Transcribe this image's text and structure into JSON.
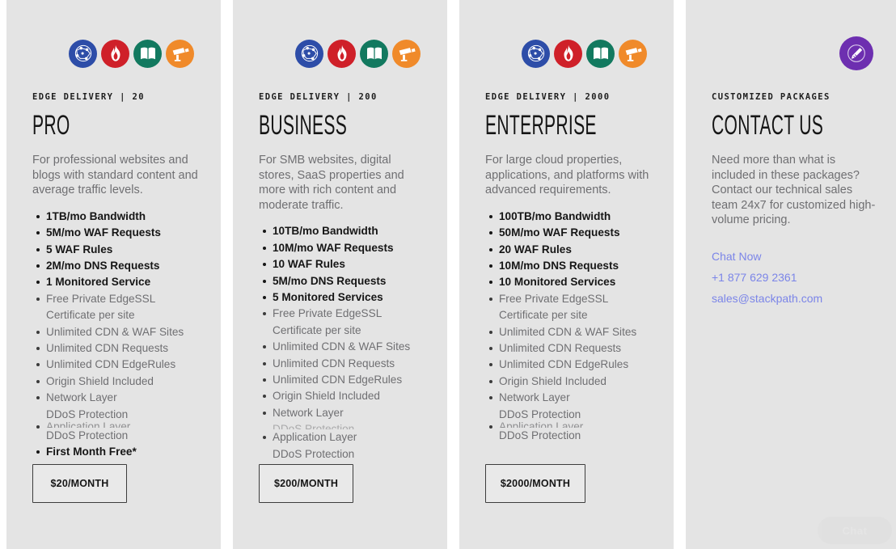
{
  "theme": {
    "page_background": "#ffffff",
    "card_background": "#e4e4e4",
    "text_dark": "#161616",
    "text_muted": "#6f6f72",
    "link_color": "#7b85e8",
    "icon_cdn_color": "#2d4da8",
    "icon_waf_color": "#cf2029",
    "icon_ssl_color": "#12795f",
    "icon_monitoring_color": "#f08a2a",
    "icon_contact_color": "#6d2fb0"
  },
  "feature_icons": [
    {
      "name": "cdn-network-icon",
      "label": "CDN",
      "color": "#2d4da8"
    },
    {
      "name": "waf-flame-icon",
      "label": "WAF",
      "color": "#cf2029"
    },
    {
      "name": "edgessl-book-icon",
      "label": "EdgeSSL",
      "color": "#12795f"
    },
    {
      "name": "monitoring-camera-icon",
      "label": "Monitoring",
      "color": "#f08a2a"
    }
  ],
  "contact_icon": {
    "name": "pencil-icon",
    "label": "Customized",
    "color": "#6d2fb0"
  },
  "plans": [
    {
      "id": "pro",
      "eyebrow": "EDGE DELIVERY  |  20",
      "title": "PRO",
      "description": "For professional websites and blogs with standard content and average traffic levels.",
      "features": [
        {
          "text": "1TB/mo Bandwidth",
          "bold": true
        },
        {
          "text": "5M/mo WAF Requests",
          "bold": true
        },
        {
          "text": "5 WAF Rules",
          "bold": true
        },
        {
          "text": "2M/mo DNS Requests",
          "bold": true
        },
        {
          "text": "1 Monitored Service",
          "bold": true
        },
        {
          "text": "Free Private EdgeSSL Certificate per site",
          "bold": false
        },
        {
          "text": "Unlimited CDN & WAF Sites",
          "bold": false
        },
        {
          "text": "Unlimited CDN Requests",
          "bold": false
        },
        {
          "text": "Unlimited CDN EdgeRules",
          "bold": false
        },
        {
          "text": "Origin Shield Included",
          "bold": false
        },
        {
          "text": "Network Layer",
          "sub": "DDoS Protection",
          "bold": false
        },
        {
          "text": "Application Layer",
          "sub": "DDoS Protection",
          "bold": false,
          "artifact": true
        },
        {
          "text": "First Month Free*",
          "bold": true
        }
      ],
      "price_label": "$20/MONTH"
    },
    {
      "id": "business",
      "eyebrow": "EDGE DELIVERY  |  200",
      "title": "BUSINESS",
      "description": "For SMB websites, digital stores, SaaS properties and more with rich content and moderate traffic.",
      "features": [
        {
          "text": "10TB/mo Bandwidth",
          "bold": true
        },
        {
          "text": "10M/mo WAF Requests",
          "bold": true
        },
        {
          "text": "10 WAF Rules",
          "bold": true
        },
        {
          "text": "5M/mo DNS Requests",
          "bold": true
        },
        {
          "text": "5 Monitored Services",
          "bold": true
        },
        {
          "text": "Free Private EdgeSSL Certificate per site",
          "bold": false
        },
        {
          "text": "Unlimited CDN & WAF Sites",
          "bold": false
        },
        {
          "text": "Unlimited CDN Requests",
          "bold": false
        },
        {
          "text": "Unlimited CDN EdgeRules",
          "bold": false
        },
        {
          "text": "Origin Shield Included",
          "bold": false
        },
        {
          "text": "Network Layer",
          "sub": "DDoS Protection",
          "bold": false,
          "sub_clipped": true
        },
        {
          "text": "Application Layer",
          "sub": "DDoS Protection",
          "bold": false
        }
      ],
      "price_label": "$200/MONTH"
    },
    {
      "id": "enterprise",
      "eyebrow": "EDGE DELIVERY  |  2000",
      "title": "ENTERPRISE",
      "description": "For large cloud properties, applications, and platforms with advanced requirements.",
      "features": [
        {
          "text": "100TB/mo Bandwidth",
          "bold": true
        },
        {
          "text": "50M/mo WAF Requests",
          "bold": true
        },
        {
          "text": "20 WAF Rules",
          "bold": true
        },
        {
          "text": "10M/mo DNS Requests",
          "bold": true
        },
        {
          "text": "10 Monitored Services",
          "bold": true
        },
        {
          "text": "Free Private EdgeSSL Certificate per site",
          "bold": false
        },
        {
          "text": "Unlimited CDN & WAF Sites",
          "bold": false
        },
        {
          "text": "Unlimited CDN Requests",
          "bold": false
        },
        {
          "text": "Unlimited CDN EdgeRules",
          "bold": false
        },
        {
          "text": "Origin Shield Included",
          "bold": false
        },
        {
          "text": "Network Layer",
          "sub": "DDoS Protection",
          "bold": false
        },
        {
          "text": "Application Layer",
          "sub": "DDoS Protection",
          "bold": false,
          "artifact": true
        }
      ],
      "price_label": "$2000/MONTH"
    }
  ],
  "contact_card": {
    "id": "contact",
    "eyebrow": "CUSTOMIZED PACKAGES",
    "title": "CONTACT US",
    "description": "Need more than what is included in these packages? Contact our technical sales team 24x7 for customized high-volume pricing.",
    "links": [
      {
        "name": "chat-now-link",
        "label": "Chat Now"
      },
      {
        "name": "phone-link",
        "label": "+1 877 629 2361"
      },
      {
        "name": "email-link",
        "label": "sales@stackpath.com"
      }
    ]
  },
  "chat_widget": {
    "label": "Chat"
  }
}
